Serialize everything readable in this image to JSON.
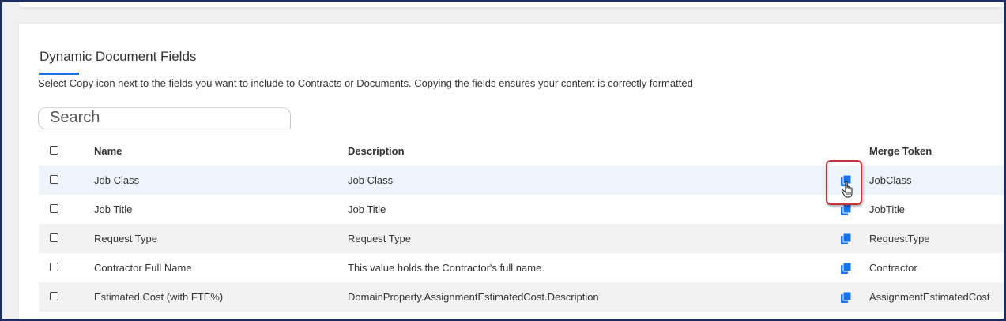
{
  "panel": {
    "title": "Dynamic Document Fields",
    "subtitle": "Select Copy icon next to the fields you want to include to Contracts or Documents. Copying the fields ensures your content is correctly formatted"
  },
  "search": {
    "placeholder": "Search",
    "value": ""
  },
  "table": {
    "headers": {
      "name": "Name",
      "description": "Description",
      "merge_token": "Merge Token"
    },
    "rows": [
      {
        "name": "Job Class",
        "description": "Job Class",
        "token": "JobClass"
      },
      {
        "name": "Job Title",
        "description": "Job Title",
        "token": "JobTitle"
      },
      {
        "name": "Request Type",
        "description": "Request Type",
        "token": "RequestType"
      },
      {
        "name": "Contractor Full Name",
        "description": "This value holds the Contractor's full name.",
        "token": "Contractor"
      },
      {
        "name": "Estimated Cost (with FTE%)",
        "description": "DomainProperty.AssignmentEstimatedCost.Description",
        "token": "AssignmentEstimatedCost"
      }
    ]
  },
  "icons": {
    "copy": "copy-icon",
    "cursor": "hand-pointer-cursor"
  },
  "colors": {
    "accent": "#1a73e8",
    "highlight": "#c0353a",
    "frame": "#1f2d5c"
  }
}
